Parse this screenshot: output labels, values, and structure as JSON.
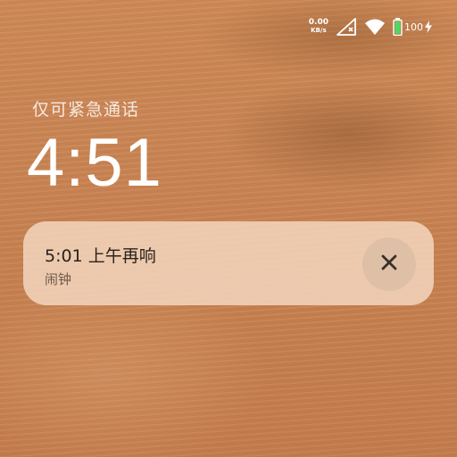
{
  "status_bar": {
    "net_speed_value": "0.00",
    "net_speed_unit": "KB/s",
    "battery_level": "100",
    "icons": [
      "signal-no-sim-icon",
      "wifi-icon",
      "battery-icon",
      "charging-bolt-icon"
    ],
    "battery_color": "#4cd964"
  },
  "lockscreen": {
    "emergency_text": "仅可紧急通话",
    "time": "4:51"
  },
  "notification": {
    "title": "5:01 上午再响",
    "subtitle": "闹钟",
    "dismiss_icon": "close-icon"
  }
}
